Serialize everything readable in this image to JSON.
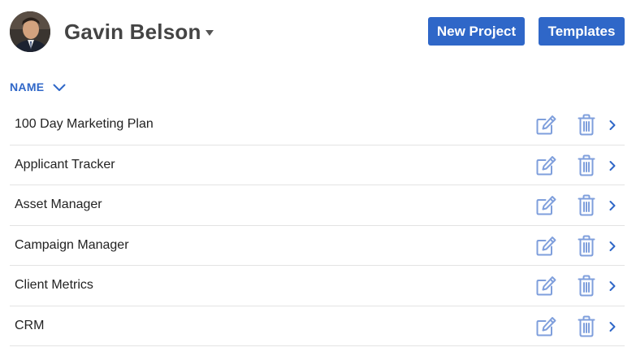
{
  "header": {
    "user_name": "Gavin Belson",
    "avatar_icon": "user-avatar",
    "caret_icon": "caret-down-icon",
    "new_project_label": "New Project",
    "templates_label": "Templates"
  },
  "list": {
    "sort_label": "NAME",
    "sort_icon": "chevron-down-icon",
    "items": [
      {
        "name": "100 Day Marketing Plan"
      },
      {
        "name": "Applicant Tracker"
      },
      {
        "name": "Asset Manager"
      },
      {
        "name": "Campaign Manager"
      },
      {
        "name": "Client Metrics"
      },
      {
        "name": "CRM"
      }
    ],
    "row_icons": [
      "edit-icon",
      "trash-icon",
      "chevron-right-icon"
    ]
  },
  "colors": {
    "accent": "#2f67c8",
    "icon": "#7f9fdc",
    "divider": "#e3e3e3",
    "name_text": "#444444"
  }
}
